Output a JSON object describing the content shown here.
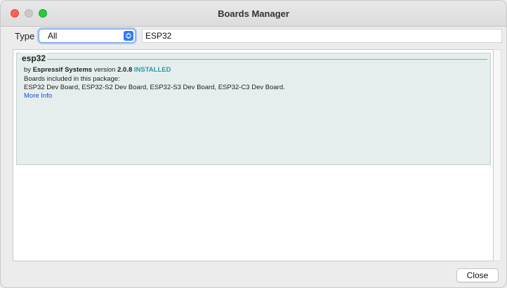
{
  "window": {
    "title": "Boards Manager"
  },
  "filter": {
    "type_label": "Type",
    "type_selected": "All",
    "search_value": "ESP32"
  },
  "entries": [
    {
      "name": "esp32",
      "by_prefix": "by",
      "author": "Espressif Systems",
      "version_prefix": "version",
      "version": "2.0.8",
      "status": "INSTALLED",
      "boards_heading": "Boards included in this package:",
      "boards": "ESP32 Dev Board, ESP32-S2 Dev Board, ESP32-S3 Dev Board, ESP32-C3 Dev Board.",
      "more_info": "More Info"
    }
  ],
  "footer": {
    "close_label": "Close"
  },
  "colors": {
    "installed": "#2b9aa0",
    "link": "#1a4fd6",
    "entry_bg": "#e5eded",
    "select_accent": "#2f7bf5"
  },
  "icons": {
    "select_stepper": "chevron-up-down-icon"
  }
}
